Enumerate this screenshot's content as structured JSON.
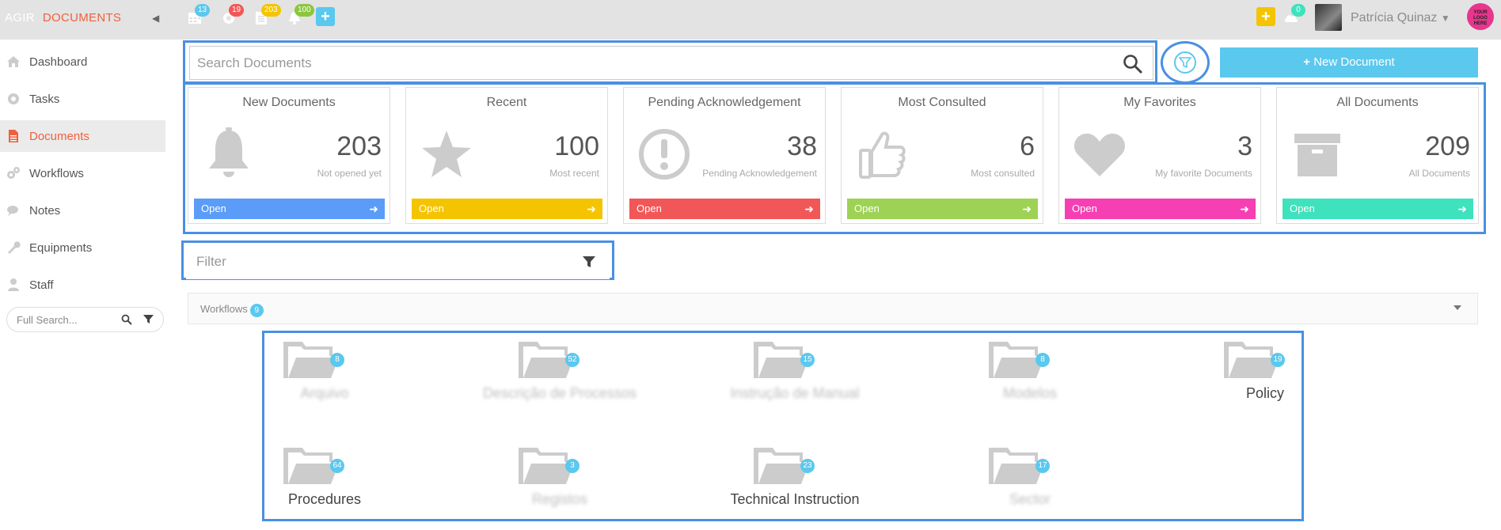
{
  "header": {
    "brand_prefix": "AGIR",
    "brand_module": "DOCUMENTS",
    "collapse_icon": "chevron-left-icon",
    "notifications": [
      {
        "icon": "calendar-icon",
        "count": "13",
        "color": "#5bc8ee"
      },
      {
        "icon": "gear-icon",
        "count": "19",
        "color": "#f25757"
      },
      {
        "icon": "document-icon",
        "count": "203",
        "color": "#f5c400"
      },
      {
        "icon": "bell-icon",
        "count": "100",
        "color": "#8cc63f"
      }
    ],
    "right_badge_count": "0",
    "user_name": "Patrícia Quinaz",
    "logo_text": "YOUR LOGO HERE"
  },
  "sidebar": {
    "items": [
      {
        "label": "Dashboard",
        "icon": "home-icon",
        "active": false
      },
      {
        "label": "Tasks",
        "icon": "gear-icon",
        "active": false
      },
      {
        "label": "Documents",
        "icon": "document-icon",
        "active": true
      },
      {
        "label": "Workflows",
        "icon": "gears-icon",
        "active": false
      },
      {
        "label": "Notes",
        "icon": "comments-icon",
        "active": false
      },
      {
        "label": "Equipments",
        "icon": "wrench-icon",
        "active": false
      },
      {
        "label": "Staff",
        "icon": "user-icon",
        "active": false
      }
    ],
    "search_placeholder": "Full Search..."
  },
  "main": {
    "search_placeholder": "Search Documents",
    "new_document_label": "New Document",
    "cards": [
      {
        "title": "New Documents",
        "count": "203",
        "subtitle": "Not opened yet",
        "open_label": "Open",
        "color": "#5a9cf8",
        "icon": "bell-icon"
      },
      {
        "title": "Recent",
        "count": "100",
        "subtitle": "Most recent",
        "open_label": "Open",
        "color": "#f5c400",
        "icon": "star-icon"
      },
      {
        "title": "Pending Acknowledgement",
        "count": "38",
        "subtitle": "Pending Acknowledgement",
        "open_label": "Open",
        "color": "#f25757",
        "icon": "exclamation-circle-icon"
      },
      {
        "title": "Most Consulted",
        "count": "6",
        "subtitle": "Most consulted",
        "open_label": "Open",
        "color": "#9ed255",
        "icon": "thumbs-up-icon"
      },
      {
        "title": "My Favorites",
        "count": "3",
        "subtitle": "My favorite Documents",
        "open_label": "Open",
        "color": "#f53fb2",
        "icon": "heart-icon"
      },
      {
        "title": "All Documents",
        "count": "209",
        "subtitle": "All Documents",
        "open_label": "Open",
        "color": "#3ee2bd",
        "icon": "archive-box-icon"
      }
    ],
    "filter_placeholder": "Filter",
    "workflows_label": "Workflows",
    "workflows_count": "9",
    "folders": [
      {
        "name": "Arquivo",
        "count": "8",
        "blurred": true
      },
      {
        "name": "Descrição de Processos",
        "count": "52",
        "blurred": true
      },
      {
        "name": "Instrução de Manual",
        "count": "15",
        "blurred": true
      },
      {
        "name": "Modelos",
        "count": "8",
        "blurred": true
      },
      {
        "name": "Policy",
        "count": "19",
        "blurred": false
      },
      {
        "name": "Procedures",
        "count": "64",
        "blurred": false
      },
      {
        "name": "Registos",
        "count": "3",
        "blurred": true
      },
      {
        "name": "Technical Instruction",
        "count": "23",
        "blurred": false
      },
      {
        "name": "Sector",
        "count": "17",
        "blurred": true
      }
    ]
  }
}
